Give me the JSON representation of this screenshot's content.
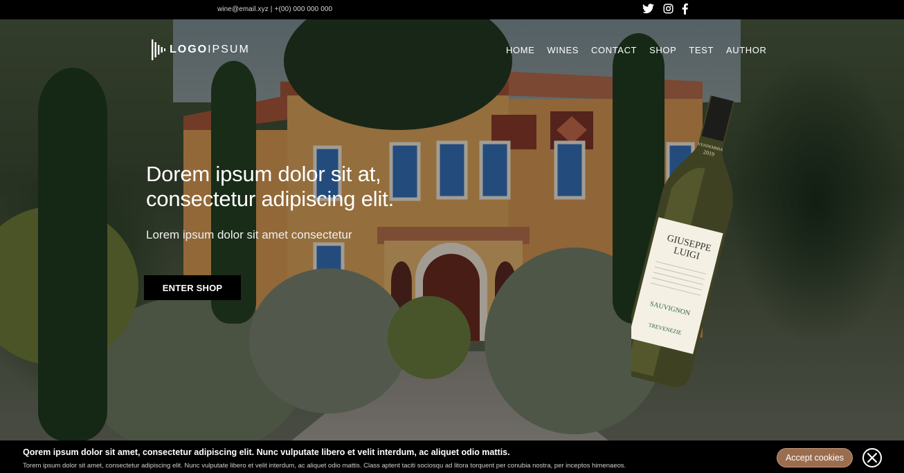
{
  "topbar": {
    "email": "wine@email.xyz",
    "separator": "|",
    "phone": "+(00) 000 000 000",
    "social": [
      "twitter-icon",
      "instagram-icon",
      "facebook-icon"
    ]
  },
  "header": {
    "logo_bold": "LOGO",
    "logo_light": "IPSUM",
    "nav": [
      "HOME",
      "WINES",
      "CONTACT",
      "SHOP",
      "TEST",
      "AUTHOR"
    ]
  },
  "hero": {
    "headline_line1": "Dorem ipsum dolor sit at,",
    "headline_line2": "consectetur adipiscing elit.",
    "subline": "Lorem ipsum dolor sit amet consectetur",
    "cta": "ENTER SHOP"
  },
  "bottle": {
    "vintage_label": "VENDEMMIA",
    "year": "2019",
    "brand_line1": "GIUSEPPE",
    "brand_line2": "LUIGI",
    "variety": "SAUVIGNON",
    "region": "TREVENEZIE"
  },
  "cookie": {
    "title": "Qorem ipsum dolor sit amet, consectetur adipiscing elit. Nunc vulputate libero et velit interdum, ac aliquet odio mattis.",
    "text": "Torem ipsum dolor sit amet, consectetur adipiscing elit. Nunc vulputate libero et velit interdum, ac aliquet odio mattis. Class aptent taciti sociosqu ad litora torquent per conubia nostra, per inceptos himenaeos.",
    "accept_label": "Accept cookies"
  },
  "colors": {
    "accent": "#9b6d4f",
    "bar": "#000000"
  }
}
